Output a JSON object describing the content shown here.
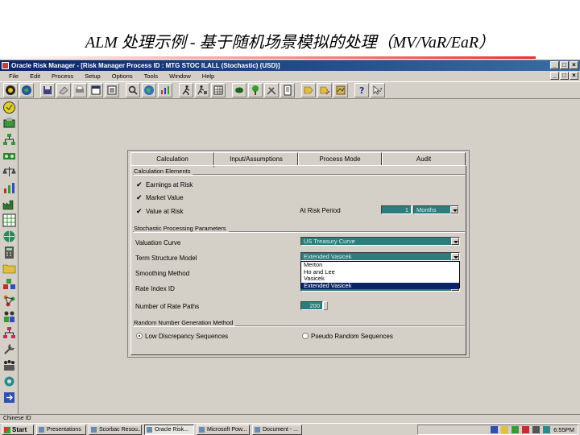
{
  "slide": {
    "title": "ALM 处理示例 - 基于随机场景模拟的处理（MV/VaR/EaR）"
  },
  "window": {
    "title": "Oracle Risk Manager - [Risk Manager Process ID : MTG STOC ILALL (Stochastic) (USD)]",
    "controls": [
      "_",
      "□",
      "×"
    ]
  },
  "menu": {
    "items": [
      "File",
      "Edit",
      "Process",
      "Setup",
      "Options",
      "Tools",
      "Window",
      "Help"
    ]
  },
  "dialog": {
    "tabs": [
      "Calculation",
      "Input/Assumptions",
      "Process Mode",
      "Audit"
    ],
    "active_tab": "Calculation",
    "calculation_elements": {
      "title": "Calculation Elements",
      "items": [
        {
          "label": "Earnings at Risk",
          "checked": true
        },
        {
          "label": "Market Value",
          "checked": true
        },
        {
          "label": "Value at Risk",
          "checked": true
        }
      ],
      "at_risk_period_label": "At Risk Period",
      "at_risk_period_value": "1",
      "at_risk_period_unit": "Months"
    },
    "stochastic": {
      "title": "Stochastic Processing Parameters",
      "valuation_curve_label": "Valuation Curve",
      "valuation_curve_value": "US Treasury Curve",
      "term_structure_label": "Term Structure Model",
      "term_structure_value": "Extended Vasicek",
      "smoothing_label": "Smoothing Method",
      "rate_index_label": "Rate Index ID",
      "num_paths_label": "Number of Rate Paths",
      "num_paths_value": "200",
      "dropdown_options": [
        "Merton",
        "Ho and Lee",
        "Vasicek",
        "Extended Vasicek"
      ],
      "dropdown_selected": "Extended Vasicek"
    },
    "random": {
      "title": "Random Number Generation Method",
      "options": [
        {
          "label": "Low Discrepancy Sequences",
          "selected": true
        },
        {
          "label": "Pseudo Random Sequences",
          "selected": false
        }
      ]
    }
  },
  "statusbar": {
    "text": "Chinese ID"
  },
  "taskbar": {
    "start_label": "Start",
    "tasks": [
      "Presentations",
      "Scorbac Resou...",
      "Oracle Risk...",
      "Microsoft Pow...",
      "Document - ..."
    ],
    "active_task": "Oracle Risk...",
    "clock": "6:55PM"
  },
  "colors": {
    "window_bg": "#d4d0c8",
    "title_bar": "#0a246a",
    "field_teal": "#2c7d7d",
    "selection": "#0a246a"
  }
}
